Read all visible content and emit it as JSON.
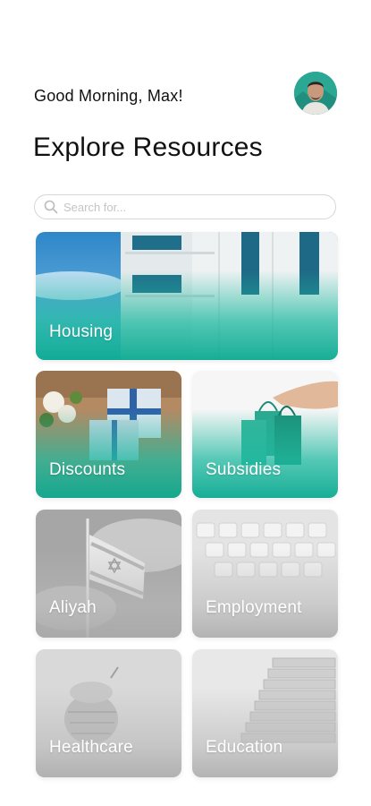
{
  "header": {
    "greeting": "Good Morning, Max!",
    "avatar_icon": "user-avatar"
  },
  "page": {
    "title": "Explore Resources"
  },
  "search": {
    "placeholder": "Search for...",
    "value": "",
    "icon": "search-icon"
  },
  "colors": {
    "accent_teal": "#1eb9a0",
    "inactive_gray": "#b5b5b5"
  },
  "categories": [
    {
      "label": "Housing",
      "state": "active"
    },
    {
      "label": "Discounts",
      "state": "active"
    },
    {
      "label": "Subsidies",
      "state": "active"
    },
    {
      "label": "Aliyah",
      "state": "inactive"
    },
    {
      "label": "Employment",
      "state": "inactive"
    },
    {
      "label": "Healthcare",
      "state": "inactive"
    },
    {
      "label": "Education",
      "state": "inactive"
    }
  ]
}
